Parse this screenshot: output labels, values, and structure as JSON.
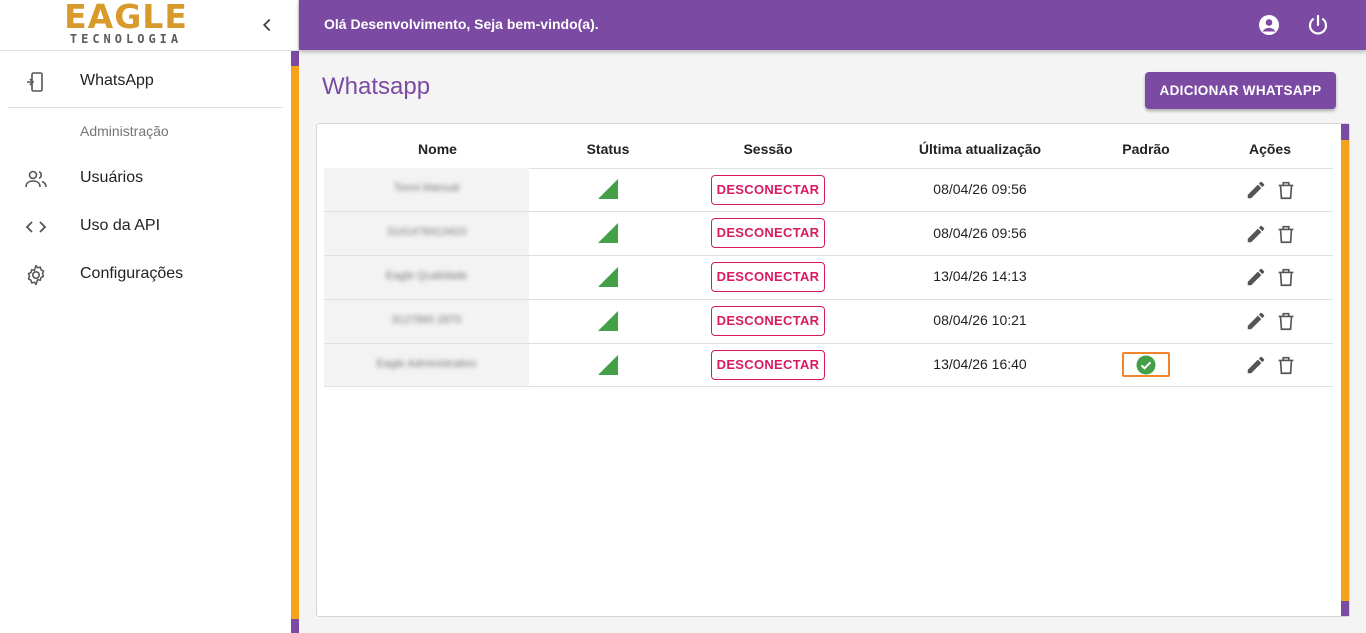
{
  "app": {
    "logo_main": "EAGLE",
    "logo_sub": "TECNOLOGIA",
    "welcome": "Olá Desenvolvimento, Seja bem-vindo(a)."
  },
  "sidebar": {
    "items": [
      {
        "label": "WhatsApp",
        "icon": "phone-settings-icon"
      },
      {
        "label": "Usuários",
        "icon": "users-icon"
      },
      {
        "label": "Uso da API",
        "icon": "code-icon"
      },
      {
        "label": "Configurações",
        "icon": "gear-icon"
      }
    ],
    "subheader": "Administração"
  },
  "main": {
    "title": "Whatsapp",
    "add_button": "ADICIONAR WHATSAPP",
    "table": {
      "headers": {
        "nome": "Nome",
        "status": "Status",
        "sessao": "Sessão",
        "ultima": "Última atualização",
        "padrao": "Padrão",
        "acoes": "Ações"
      },
      "rows": [
        {
          "name": "Tonni Manual",
          "status": "connected",
          "session_button": "DESCONECTAR",
          "updated": "08/04/26 09:56",
          "default": false
        },
        {
          "name": "3141478413423",
          "status": "connected",
          "session_button": "DESCONECTAR",
          "updated": "08/04/26 09:56",
          "default": false
        },
        {
          "name": "Eagle Qualidade",
          "status": "connected",
          "session_button": "DESCONECTAR",
          "updated": "13/04/26 14:13",
          "default": false
        },
        {
          "name": "3127860 2870",
          "status": "connected",
          "session_button": "DESCONECTAR",
          "updated": "08/04/26 10:21",
          "default": false
        },
        {
          "name": "Eagle Administrativo",
          "status": "connected",
          "session_button": "DESCONECTAR",
          "updated": "13/04/26 16:40",
          "default": true
        }
      ]
    }
  },
  "colors": {
    "primary": "#7b4aa3",
    "accent_orange": "#f5a31d",
    "logo_gold": "#d79a2b",
    "danger": "#d81b60",
    "success": "#43a047",
    "highlight": "#f0852d"
  }
}
